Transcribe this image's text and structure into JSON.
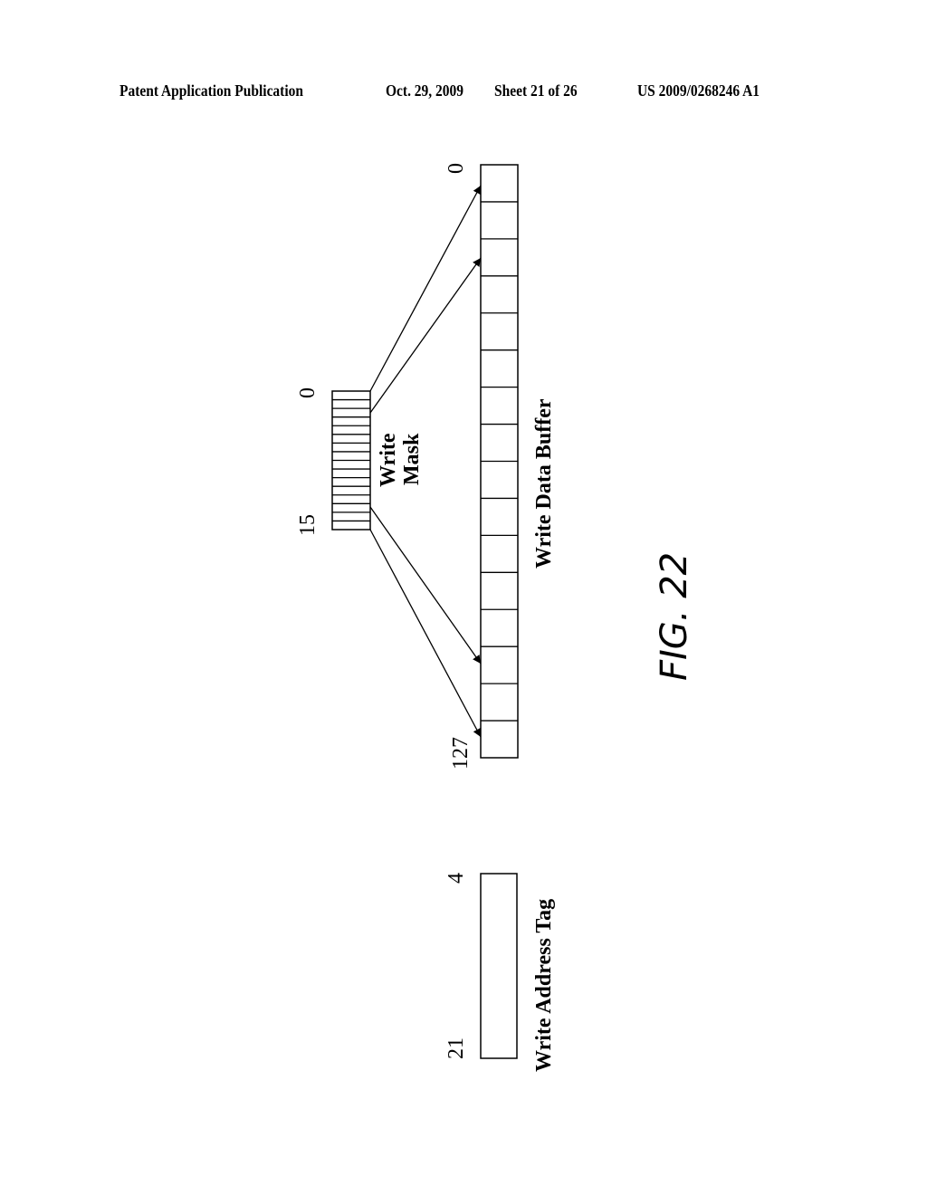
{
  "header": {
    "publication": "Patent Application Publication",
    "date": "Oct. 29, 2009",
    "sheet": "Sheet 21 of 26",
    "number": "US 2009/0268246 A1"
  },
  "figure": {
    "label": "FIG. 22",
    "write_mask": {
      "title_line1": "Write",
      "title_line2": "Mask",
      "index_high": "15",
      "index_low": "0",
      "cells": 16
    },
    "write_data_buffer": {
      "title": "Write Data Buffer",
      "index_low": "0",
      "index_high": "127",
      "cells": 16
    },
    "write_address_tag": {
      "title": "Write Address Tag",
      "index_high": "21",
      "index_low": "4"
    }
  }
}
